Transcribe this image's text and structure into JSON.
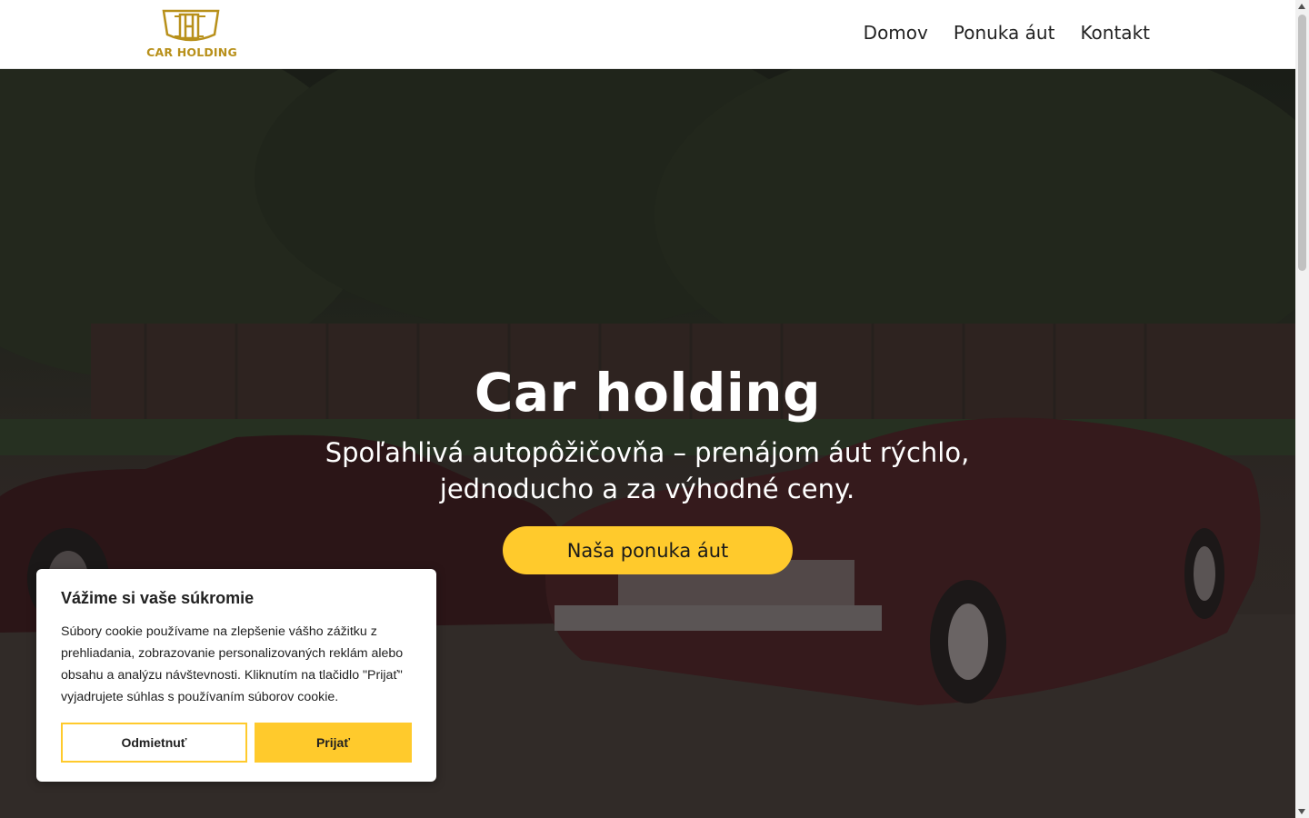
{
  "brand": {
    "name": "CAR HOLDING",
    "logo_icon": "ch-shield-logo",
    "accent_color": "#ffca2c",
    "logo_color": "#b8901a"
  },
  "nav": {
    "items": [
      {
        "label": "Domov"
      },
      {
        "label": "Ponuka áut"
      },
      {
        "label": "Kontakt"
      }
    ]
  },
  "hero": {
    "title": "Car holding",
    "subtitle": "Spoľahlivá autopôžičovňa – prenájom áut rýchlo, jednoducho a za výhodné ceny.",
    "cta_label": "Naša ponuka áut",
    "background_image": "two-vintage-convertibles-photo"
  },
  "cookie_banner": {
    "title": "Vážime si vaše súkromie",
    "text": "Súbory cookie používame na zlepšenie vášho zážitku z prehliadania, zobrazovanie personalizovaných reklám alebo obsahu a analýzu návštevnosti. Kliknutím na tlačidlo \"Prijať\" vyjadrujete súhlas s používaním súborov cookie.",
    "reject_label": "Odmietnuť",
    "accept_label": "Prijať"
  }
}
